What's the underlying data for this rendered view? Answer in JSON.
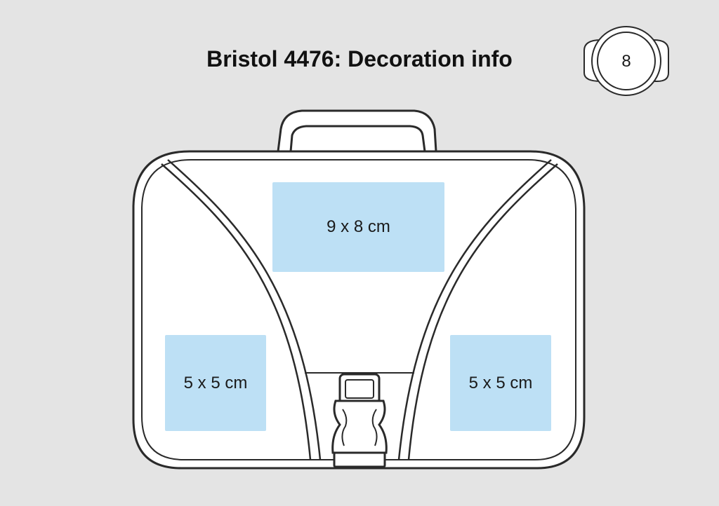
{
  "title": "Bristol 4476: Decoration info",
  "badge": {
    "label": "8"
  },
  "print_areas": [
    {
      "id": "top",
      "label": "9 x 8 cm"
    },
    {
      "id": "left",
      "label": "5 x 5 cm"
    },
    {
      "id": "right",
      "label": "5 x 5 cm"
    }
  ],
  "colors": {
    "background": "#e4e4e4",
    "outline": "#2a2a2a",
    "bag_fill": "#ffffff",
    "print_area_fill": "#bde0f5"
  }
}
